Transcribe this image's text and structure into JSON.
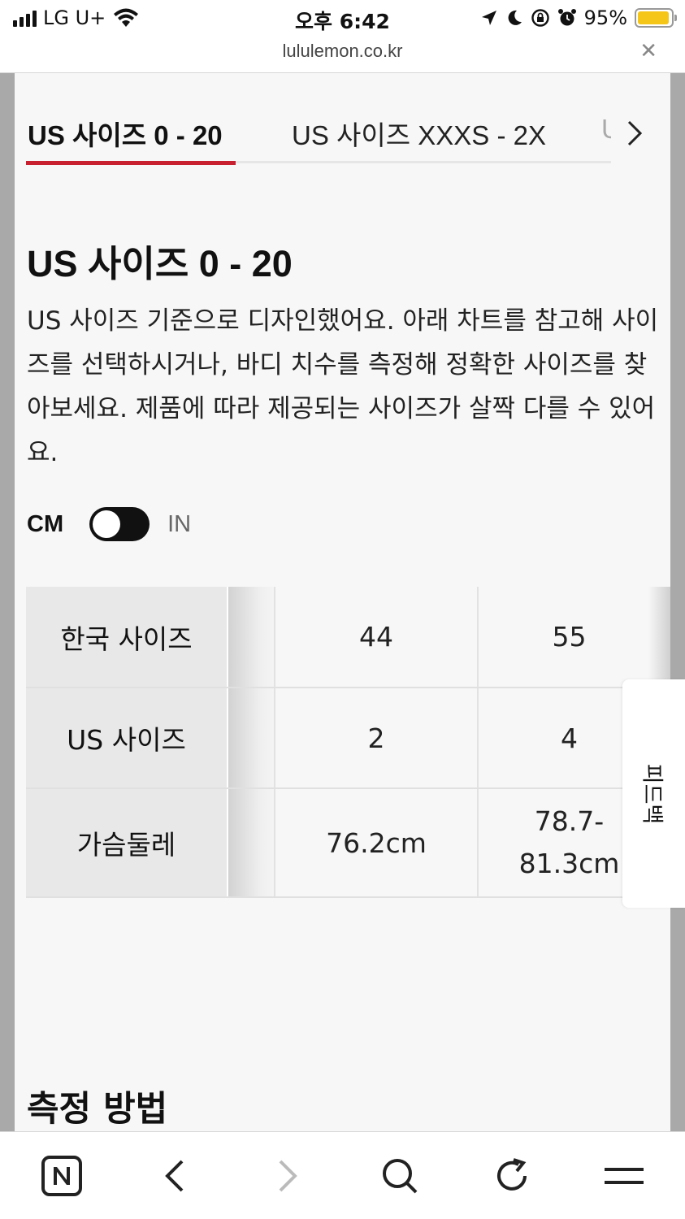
{
  "status_bar": {
    "carrier": "LG U+",
    "time": "오후 6:42",
    "battery": "95%",
    "battery_level": 0.95,
    "battery_color": "#f5c518"
  },
  "browser": {
    "url": "lululemon.co.kr",
    "close_icon": "close-icon"
  },
  "tabs": [
    {
      "label": "US 사이즈 0 - 20",
      "active": true
    },
    {
      "label": "US 사이즈 XXXS - 2X",
      "active": false
    },
    {
      "label": "U",
      "active": false
    }
  ],
  "accent_color": "#c8202f",
  "section": {
    "title": "US 사이즈 0 - 20",
    "description": "US 사이즈 기준으로 디자인했어요. 아래 차트를 참고해 사이즈를 선택하시거나, 바디 치수를 측정해 정확한 사이즈를 찾아보세요. 제품에 따라 제공되는 사이즈가 살짝 다를 수 있어요."
  },
  "unit_toggle": {
    "left": "CM",
    "right": "IN",
    "selected": "CM"
  },
  "size_table": {
    "rows": [
      {
        "header": "한국 사이즈",
        "values": [
          "44",
          "55"
        ]
      },
      {
        "header": "US 사이즈",
        "values": [
          "2",
          "4"
        ]
      },
      {
        "header": "가슴둘레",
        "values": [
          "76.2cm",
          "78.7-",
          "81.3cm"
        ]
      }
    ]
  },
  "feedback_tab": "피드백",
  "how_to_measure": "측정 방법",
  "toolbar": {
    "icons": [
      "naver-icon",
      "back-arrow-icon",
      "forward-arrow-icon",
      "search-icon",
      "reload-icon",
      "menu-icon"
    ]
  }
}
